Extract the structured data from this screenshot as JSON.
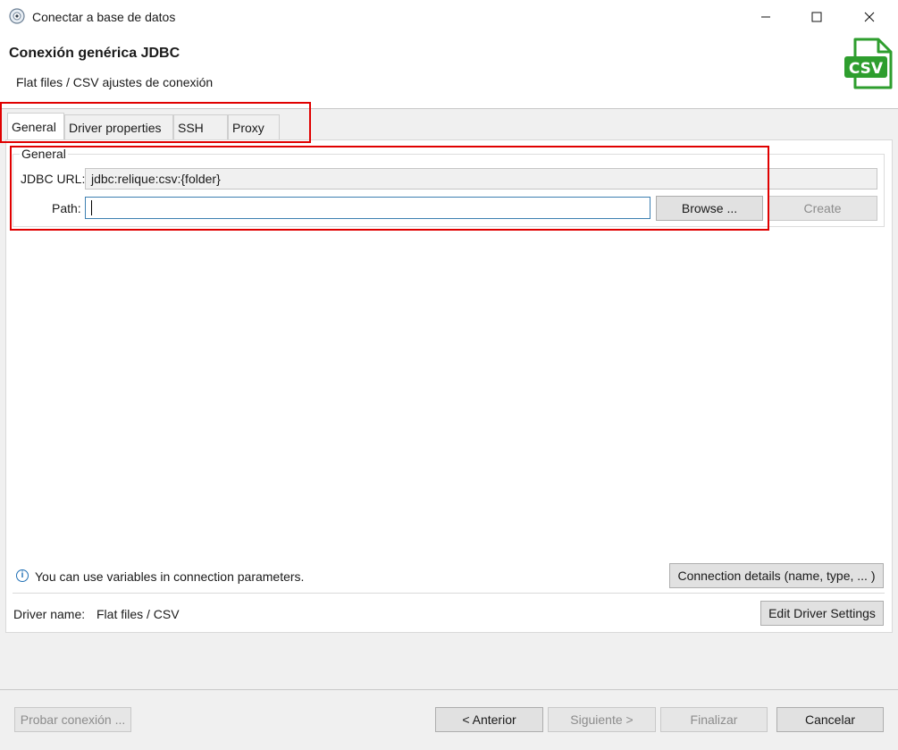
{
  "window": {
    "title": "Conectar a base de datos",
    "controls": {
      "minimize": "—",
      "maximize": "☐",
      "close": "✕"
    }
  },
  "header": {
    "title": "Conexión genérica JDBC",
    "subtitle": "Flat files / CSV ajustes de conexión",
    "logo_text": "CSV",
    "logo_color": "#2e9e2e"
  },
  "tabs": [
    {
      "label": "General",
      "active": true
    },
    {
      "label": "Driver properties",
      "active": false
    },
    {
      "label": "SSH",
      "active": false
    },
    {
      "label": "Proxy",
      "active": false
    }
  ],
  "general": {
    "group_label": "General",
    "jdbc_url_label": "JDBC URL:",
    "jdbc_url_value": "jdbc:relique:csv:{folder}",
    "path_label": "Path:",
    "path_value": "",
    "browse_button": "Browse ...",
    "create_button": "Create"
  },
  "info": {
    "icon": "info-icon",
    "text": "You can use variables in connection parameters."
  },
  "connection_details_button": "Connection details (name, type, ... )",
  "driver": {
    "label": "Driver name:",
    "value": "Flat files / CSV",
    "edit_button": "Edit Driver Settings"
  },
  "footer": {
    "test_button": "Probar conexión ...",
    "back_button": "< Anterior",
    "next_button": "Siguiente >",
    "finish_button": "Finalizar",
    "cancel_button": "Cancelar"
  },
  "colors": {
    "highlight_box": "#e00000",
    "accent": "#3c7fb1"
  }
}
